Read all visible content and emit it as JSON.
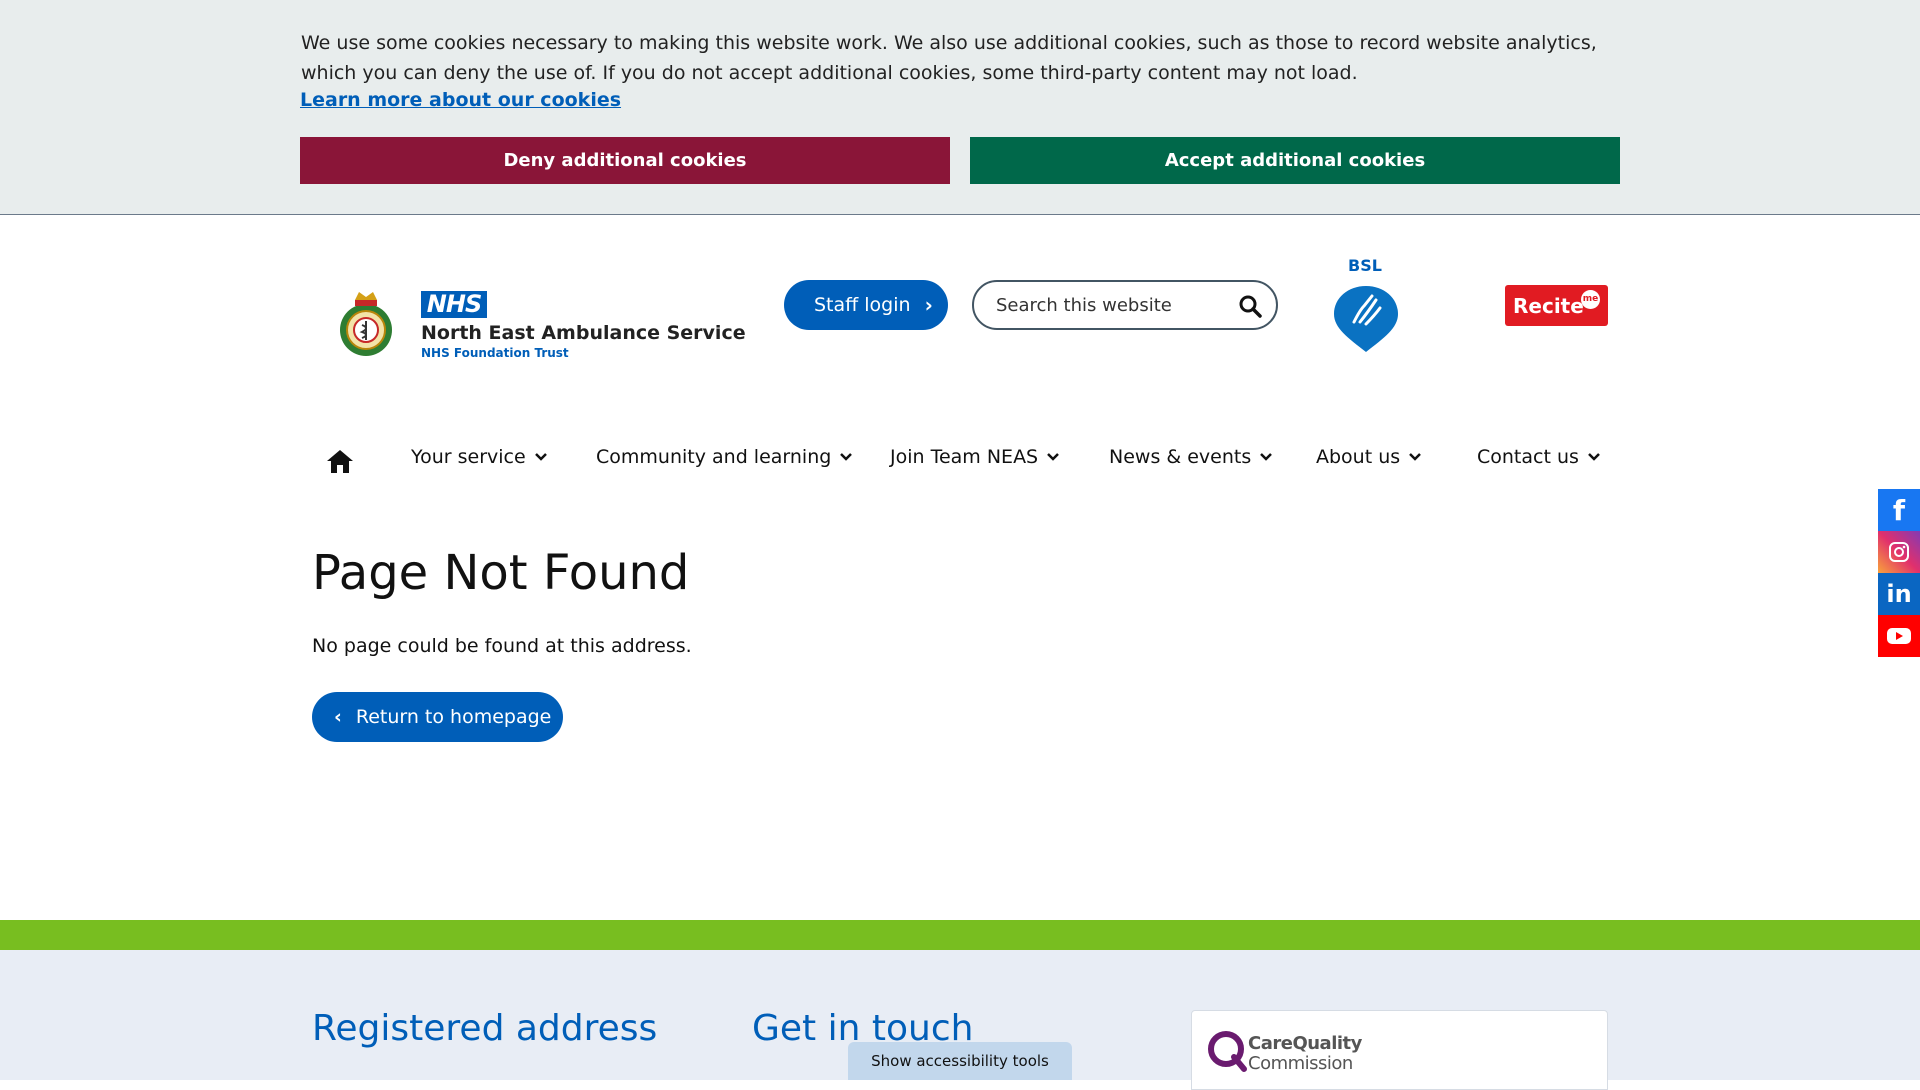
{
  "cookie_banner": {
    "text": "We use some cookies necessary to making this website work. We also use additional cookies, such as those to record website analytics, which you can deny the use of. If you do not accept additional cookies, some third-party content may not load.",
    "learn_more": "Learn more about our cookies",
    "deny_label": "Deny additional cookies",
    "accept_label": "Accept additional cookies",
    "colors": {
      "deny": "#8a1538",
      "accept": "#00684a"
    }
  },
  "header": {
    "logo": {
      "nhs": "NHS",
      "name": "North East Ambulance Service",
      "sub": "NHS Foundation Trust"
    },
    "staff_login": "Staff login",
    "search_placeholder": "Search this website",
    "bsl_label": "BSL",
    "recite_label": "Recite",
    "recite_badge": "me"
  },
  "nav": {
    "items": [
      {
        "label": "Your service"
      },
      {
        "label": "Community and learning"
      },
      {
        "label": "Join Team NEAS"
      },
      {
        "label": "News & events"
      },
      {
        "label": "About us"
      },
      {
        "label": "Contact us"
      }
    ]
  },
  "main": {
    "title": "Page Not Found",
    "message": "No page could be found at this address.",
    "return_label": "Return to homepage"
  },
  "social": [
    "facebook-icon",
    "instagram-icon",
    "linkedin-icon",
    "youtube-icon"
  ],
  "footer": {
    "registered_address": "Registered address",
    "get_in_touch": "Get in touch",
    "cqc_line1": "CareQuality",
    "cqc_line2": "Commission",
    "accessibility_tab": "Show accessibility tools"
  }
}
